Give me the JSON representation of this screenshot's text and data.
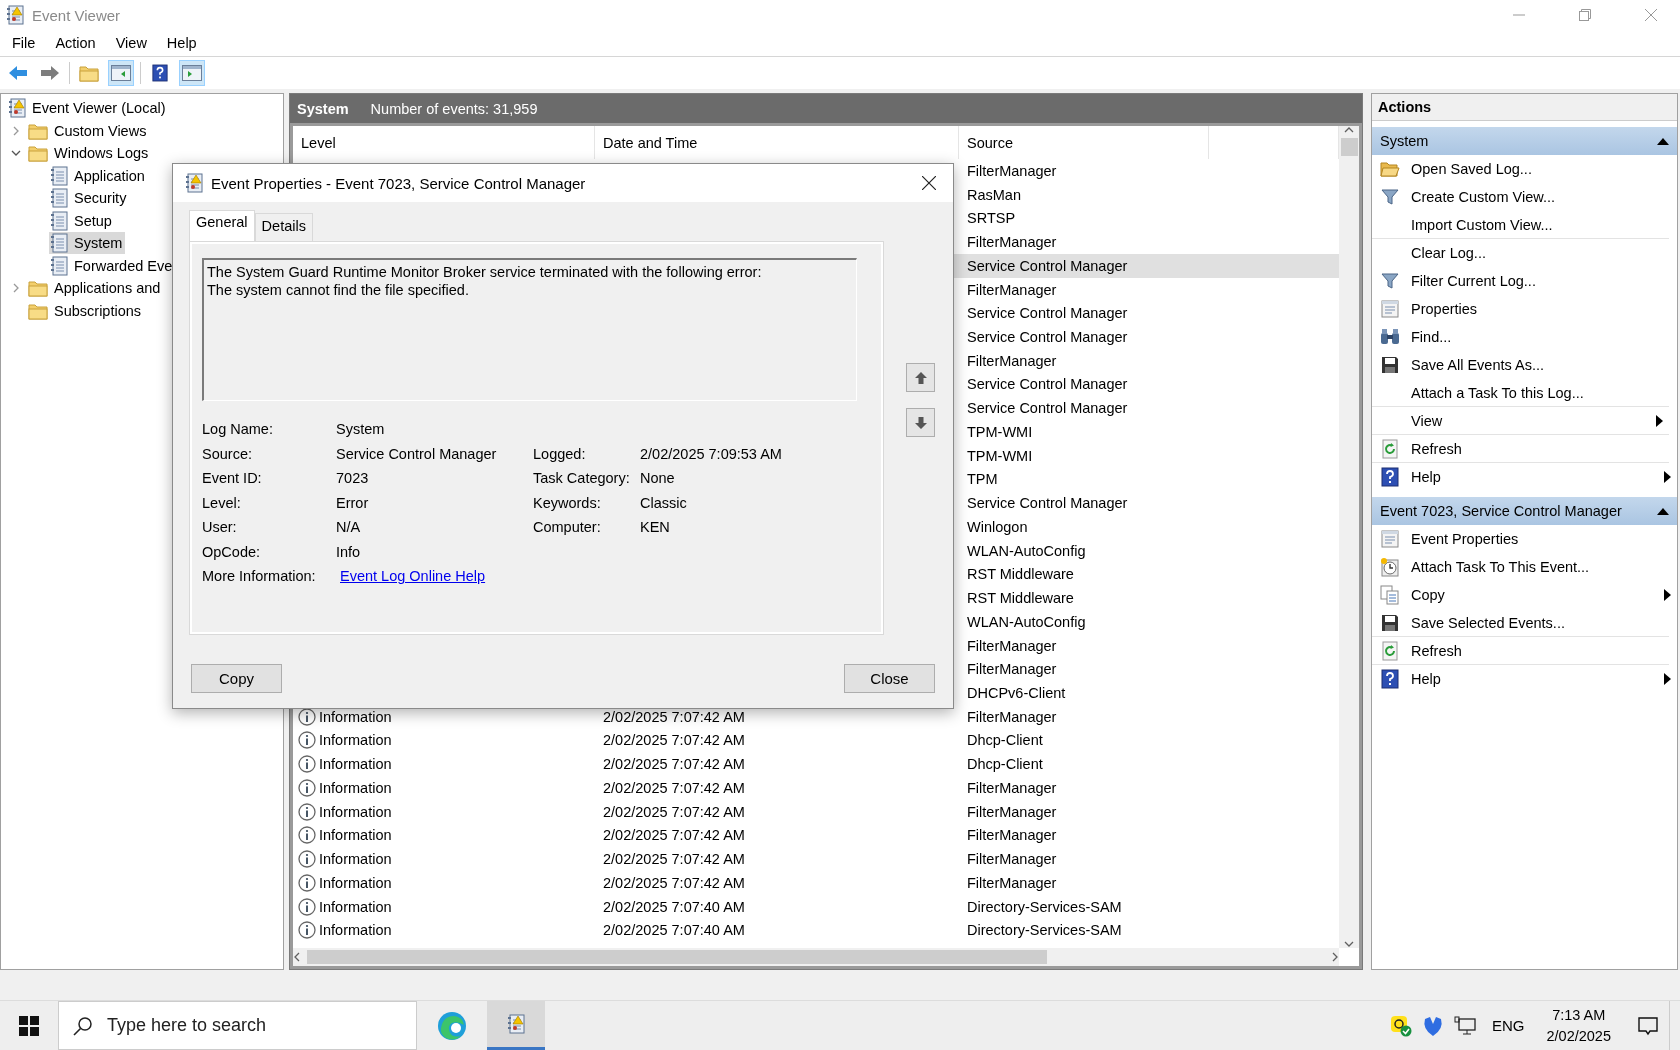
{
  "window": {
    "title": "Event Viewer"
  },
  "menu": [
    "File",
    "Action",
    "View",
    "Help"
  ],
  "tree": [
    {
      "label": "Event Viewer (Local)",
      "kind": "root",
      "selected": false,
      "children": [
        {
          "label": "Custom Views",
          "kind": "folder",
          "expanded": false,
          "selected": false
        },
        {
          "label": "Windows Logs",
          "kind": "folder",
          "expanded": true,
          "selected": false,
          "children": [
            {
              "label": "Application",
              "kind": "log",
              "selected": false
            },
            {
              "label": "Security",
              "kind": "log",
              "selected": false
            },
            {
              "label": "Setup",
              "kind": "log",
              "selected": false
            },
            {
              "label": "System",
              "kind": "log",
              "selected": true
            },
            {
              "label": "Forwarded Eve",
              "kind": "log",
              "selected": false
            }
          ]
        },
        {
          "label": "Applications and",
          "kind": "folder",
          "expanded": false,
          "selected": false
        },
        {
          "label": "Subscriptions",
          "kind": "folder",
          "selected": false
        }
      ]
    }
  ],
  "log_view": {
    "title": "System",
    "count": "Number of events: 31,959",
    "columns": [
      "Level",
      "Date and Time",
      "Source"
    ],
    "rows": [
      {
        "source": "FilterManager",
        "selected": false
      },
      {
        "source": "RasMan",
        "selected": false
      },
      {
        "source": "SRTSP",
        "selected": false
      },
      {
        "source": "FilterManager",
        "selected": false
      },
      {
        "source": "Service Control Manager",
        "selected": true
      },
      {
        "source": "FilterManager",
        "selected": false
      },
      {
        "source": "Service Control Manager",
        "selected": false
      },
      {
        "source": "Service Control Manager",
        "selected": false
      },
      {
        "source": "FilterManager",
        "selected": false
      },
      {
        "source": "Service Control Manager",
        "selected": false
      },
      {
        "source": "Service Control Manager",
        "selected": false
      },
      {
        "source": "TPM-WMI",
        "selected": false
      },
      {
        "source": "TPM-WMI",
        "selected": false
      },
      {
        "source": "TPM",
        "selected": false
      },
      {
        "source": "Service Control Manager",
        "selected": false
      },
      {
        "source": "Winlogon",
        "selected": false
      },
      {
        "source": "WLAN-AutoConfig",
        "selected": false
      },
      {
        "source": "RST Middleware",
        "selected": false
      },
      {
        "source": "RST Middleware",
        "selected": false
      },
      {
        "source": "WLAN-AutoConfig",
        "selected": false
      },
      {
        "source": "FilterManager",
        "selected": false
      },
      {
        "source": "FilterManager",
        "selected": false
      },
      {
        "source": "DHCPv6-Client",
        "selected": false
      },
      {
        "level": "Information",
        "date": "2/02/2025 7:07:42 AM",
        "source": "FilterManager",
        "selected": false
      },
      {
        "level": "Information",
        "date": "2/02/2025 7:07:42 AM",
        "source": "Dhcp-Client",
        "selected": false
      },
      {
        "level": "Information",
        "date": "2/02/2025 7:07:42 AM",
        "source": "Dhcp-Client",
        "selected": false
      },
      {
        "level": "Information",
        "date": "2/02/2025 7:07:42 AM",
        "source": "FilterManager",
        "selected": false
      },
      {
        "level": "Information",
        "date": "2/02/2025 7:07:42 AM",
        "source": "FilterManager",
        "selected": false
      },
      {
        "level": "Information",
        "date": "2/02/2025 7:07:42 AM",
        "source": "FilterManager",
        "selected": false
      },
      {
        "level": "Information",
        "date": "2/02/2025 7:07:42 AM",
        "source": "FilterManager",
        "selected": false
      },
      {
        "level": "Information",
        "date": "2/02/2025 7:07:42 AM",
        "source": "FilterManager",
        "selected": false
      },
      {
        "level": "Information",
        "date": "2/02/2025 7:07:40 AM",
        "source": "Directory-Services-SAM",
        "selected": false
      },
      {
        "level": "Information",
        "date": "2/02/2025 7:07:40 AM",
        "source": "Directory-Services-SAM",
        "selected": false
      }
    ]
  },
  "actions": {
    "title": "Actions",
    "sections": [
      {
        "title": "System",
        "expanded": true,
        "items": [
          {
            "label": "Open Saved Log...",
            "submenu": false,
            "divider_after": false
          },
          {
            "label": "Create Custom View...",
            "submenu": false,
            "divider_after": false
          },
          {
            "label": "Import Custom View...",
            "submenu": false,
            "divider_after": true
          },
          {
            "label": "Clear Log...",
            "submenu": false,
            "divider_after": false
          },
          {
            "label": "Filter Current Log...",
            "submenu": false,
            "divider_after": false
          },
          {
            "label": "Properties",
            "submenu": false,
            "divider_after": false
          },
          {
            "label": "Find...",
            "submenu": false,
            "divider_after": false
          },
          {
            "label": "Save All Events As...",
            "submenu": false,
            "divider_after": false
          },
          {
            "label": "Attach a Task To this Log...",
            "submenu": false,
            "divider_after": true
          },
          {
            "label": "View",
            "submenu": true,
            "divider_after": true
          },
          {
            "label": "Refresh",
            "submenu": false,
            "divider_after": true
          },
          {
            "label": "Help",
            "submenu": true,
            "divider_after": false
          }
        ]
      },
      {
        "title": "Event 7023, Service Control Manager",
        "expanded": true,
        "items": [
          {
            "label": "Event Properties",
            "submenu": false,
            "divider_after": false
          },
          {
            "label": "Attach Task To This Event...",
            "submenu": false,
            "divider_after": false
          },
          {
            "label": "Copy",
            "submenu": true,
            "divider_after": false
          },
          {
            "label": "Save Selected Events...",
            "submenu": false,
            "divider_after": true
          },
          {
            "label": "Refresh",
            "submenu": false,
            "divider_after": true
          },
          {
            "label": "Help",
            "submenu": true,
            "divider_after": false
          }
        ]
      }
    ]
  },
  "dialog": {
    "title": "Event Properties - Event 7023, Service Control Manager",
    "tabs": [
      {
        "label": "General",
        "selected": true
      },
      {
        "label": "Details",
        "selected": false
      }
    ],
    "description": "The System Guard Runtime Monitor Broker service terminated with the following error:\nThe system cannot find the file specified.",
    "fields_left": [
      {
        "label": "Log Name:",
        "value": "System"
      },
      {
        "label": "Source:",
        "value": "Service Control Manager"
      },
      {
        "label": "Event ID:",
        "value": "7023"
      },
      {
        "label": "Level:",
        "value": "Error"
      },
      {
        "label": "User:",
        "value": "N/A"
      },
      {
        "label": "OpCode:",
        "value": "Info"
      }
    ],
    "fields_right": [
      {
        "label": "Logged:",
        "value": "2/02/2025 7:09:53 AM"
      },
      {
        "label": "Task Category:",
        "value": "None"
      },
      {
        "label": "Keywords:",
        "value": "Classic"
      },
      {
        "label": "Computer:",
        "value": "KEN"
      }
    ],
    "more_information": {
      "label": "More Information:",
      "link": "Event Log Online Help"
    },
    "buttons": [
      "Copy",
      "Close"
    ]
  },
  "taskbar": {
    "search_placeholder": "Type here to search",
    "apps": [
      {
        "kind": "browser",
        "active": false
      },
      {
        "kind": "event-viewer",
        "active": true
      }
    ],
    "language": "ENG",
    "time": "7:13 AM",
    "date": "2/02/2025"
  }
}
